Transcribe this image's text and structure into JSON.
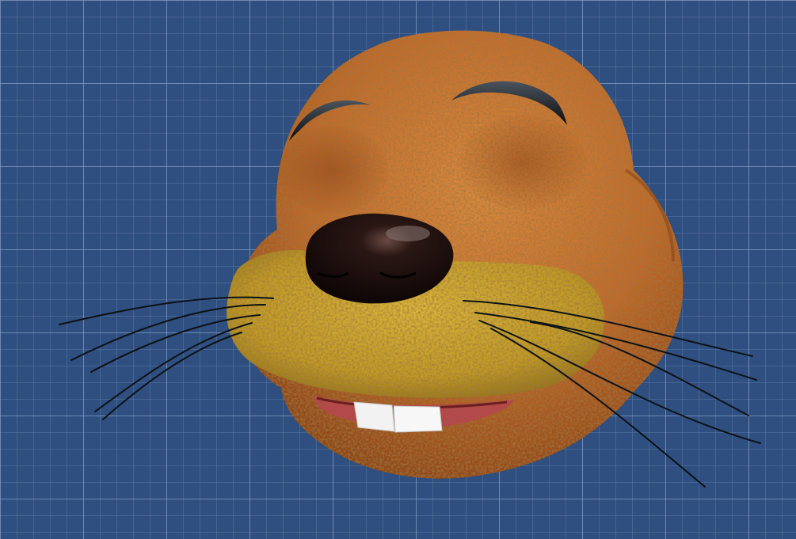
{
  "scene": {
    "subject": "mascot-head-3d-model",
    "background_style": "blueprint-grid",
    "colors": {
      "background": "#2f4f80",
      "grid_minor": "#7f9bc4",
      "grid_major": "#a9bedf",
      "head_fur": "#c8702e",
      "head_fur_dark": "#8a4317",
      "muzzle": "#c9a52b",
      "muzzle_dark": "#8f7218",
      "nose": "#1c0f0c",
      "eyebrow": "#101418",
      "mouth": "#b24a4a",
      "teeth": "#f2f2f2",
      "whisker": "#0c1216"
    }
  }
}
